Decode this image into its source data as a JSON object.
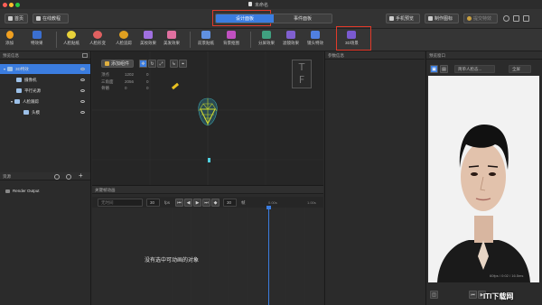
{
  "window": {
    "title": "未命名"
  },
  "toolbar": {
    "home_label": "首页",
    "tutorial_label": "在线教程",
    "tabs": [
      {
        "label": "设计面板",
        "active": true
      },
      {
        "label": "事件面板",
        "active": false
      }
    ],
    "mobile_preview_label": "手机预览",
    "make_label": "制作图标",
    "submit_label": "提交特效"
  },
  "components": [
    {
      "label": "添加",
      "color": "#f0a020"
    },
    {
      "label": "特效果",
      "color": "#3b6fd0"
    },
    {
      "label": "人脸贴纸",
      "color": "#e8d23a"
    },
    {
      "label": "人脸形变",
      "color": "#e06060"
    },
    {
      "label": "人脸追踪",
      "color": "#e0a020"
    },
    {
      "label": "美妆效果",
      "color": "#a070e0"
    },
    {
      "label": "美发效果",
      "color": "#e070a0"
    },
    {
      "label": "前景贴纸",
      "color": "#6090e0"
    },
    {
      "label": "背景抠图",
      "color": "#c050c0"
    },
    {
      "label": "分屏效果",
      "color": "#40a080"
    },
    {
      "label": "滤镜效果",
      "color": "#8060d0"
    },
    {
      "label": "镜头特效",
      "color": "#5080e0"
    },
    {
      "label": "3D场景",
      "color": "#7a5ad0"
    }
  ],
  "hierarchy": {
    "title": "预览信息",
    "items": [
      {
        "label": "3D特效",
        "level": 0,
        "selected": true
      },
      {
        "label": "摄像机",
        "level": 1,
        "selected": false
      },
      {
        "label": "平行光源",
        "level": 1,
        "selected": false
      },
      {
        "label": "人脸跟踪",
        "level": 1,
        "selected": false
      },
      {
        "label": "头模",
        "level": 2,
        "selected": false
      }
    ]
  },
  "resources": {
    "title": "资源",
    "items": [
      {
        "label": "Render Output"
      }
    ]
  },
  "viewport": {
    "add_component_label": "添加组件",
    "stats": [
      {
        "label": "顶点",
        "value": "1202",
        "extra": "0"
      },
      {
        "label": "三角面",
        "value": "2056",
        "extra": "0"
      },
      {
        "label": "骨骼",
        "value": "0",
        "extra": "0"
      }
    ],
    "axis_top": "T",
    "axis_front": "F"
  },
  "keyframe": {
    "title": "关键帧动画",
    "name_placeholder": "无时间",
    "fps_value": "30",
    "fps_label": "fps",
    "frame_value": "30",
    "frame_label": "帧",
    "time_start": "0.00s",
    "time_end": "1.00s",
    "empty_message": "没有选中可动画的对象"
  },
  "event_panel": {
    "title": "参数信息"
  },
  "preview": {
    "title": "预览窗口",
    "mode_select": "简单人脸态...",
    "ratio_select": "全屏",
    "status_text": "60fps / 0:02 / 16.5ms",
    "watermark": "ITI下载网"
  }
}
